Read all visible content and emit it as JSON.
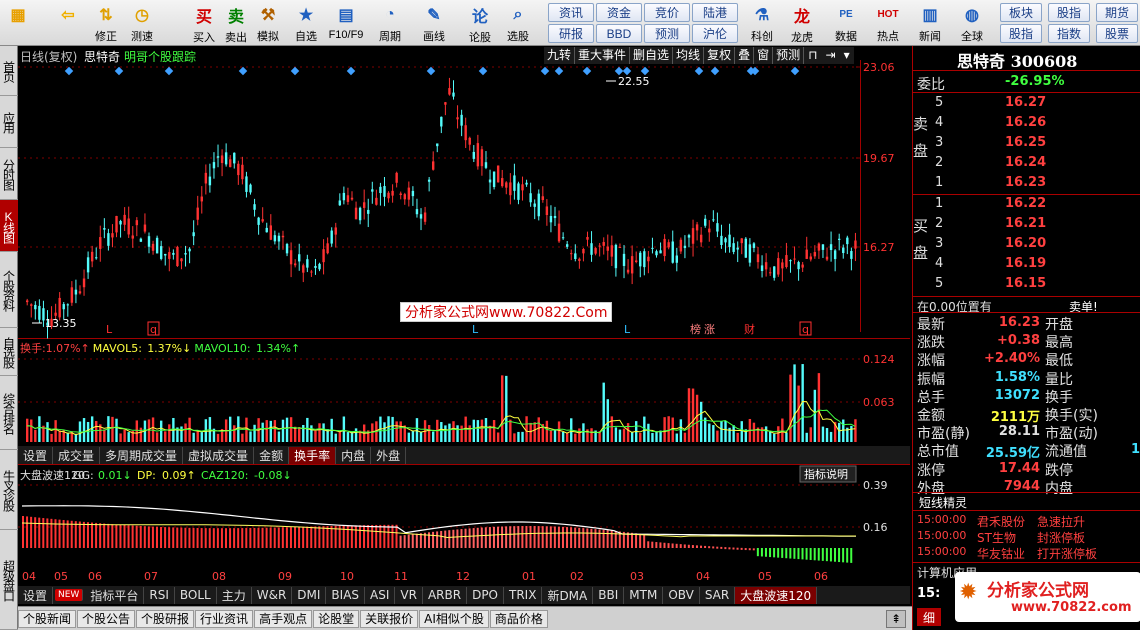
{
  "toolbar": {
    "buttons": [
      {
        "label": "",
        "icon": "grid-icon",
        "color": "#e8a000"
      },
      {
        "label": "",
        "icon": "back-arrow-icon",
        "color": "#f0b000"
      },
      {
        "label": "修正",
        "icon": "updown-arrows-icon",
        "color": "#e0a000"
      },
      {
        "label": "测速",
        "icon": "stopwatch-icon",
        "color": "#e0a000"
      },
      {
        "label": "买入",
        "icon": "buy-icon",
        "color": "#d00000"
      },
      {
        "label": "卖出",
        "icon": "sell-icon",
        "color": "#008000"
      },
      {
        "label": "模拟",
        "icon": "hammer-icon",
        "color": "#b06000"
      },
      {
        "label": "自选",
        "icon": "star-icon",
        "color": "#2060c0"
      },
      {
        "label": "F10/F9",
        "icon": "f10-icon",
        "color": "#2060c0"
      },
      {
        "label": "周期",
        "icon": "clock-icon",
        "color": "#2060c0"
      },
      {
        "label": "画线",
        "icon": "pencil-icon",
        "color": "#2060c0"
      },
      {
        "label": "论股",
        "icon": "chat-icon",
        "color": "#2060c0"
      },
      {
        "label": "选股",
        "icon": "magnifier-icon",
        "color": "#2060c0"
      },
      {
        "label": "科创",
        "icon": "kechuang-icon",
        "color": "#2060c0"
      },
      {
        "label": "龙虎",
        "icon": "dragon-icon",
        "color": "#d00000"
      },
      {
        "label": "数据",
        "icon": "pe-icon",
        "color": "#2060c0"
      },
      {
        "label": "热点",
        "icon": "hot-icon",
        "color": "#d00000"
      },
      {
        "label": "新闻",
        "icon": "news-icon",
        "color": "#2060c0"
      },
      {
        "label": "全球",
        "icon": "globe-icon",
        "color": "#2060c0"
      }
    ],
    "grid_row1": [
      "资讯",
      "资金",
      "竞价",
      "陆港"
    ],
    "grid_row2": [
      "研报",
      "BBD",
      "预测",
      "沪伦"
    ],
    "grid2_row1": [
      "板块",
      "股指",
      "期货"
    ],
    "grid2_row2": [
      "股指",
      "指数",
      "股票"
    ]
  },
  "leftbar": [
    "首页",
    "应用",
    "分时图",
    "K线图",
    "个股资料",
    "自选股",
    "综合排名",
    "牛叉诊股",
    "超级盘口"
  ],
  "header": {
    "period": "日线(复权)",
    "stock_name": "思特奇",
    "follow": "明哥个股跟踪",
    "menu": [
      "九转",
      "重大事件",
      "删自选",
      "均线",
      "复权",
      "叠",
      "窗",
      "预测"
    ]
  },
  "price_axis": [
    "23.06",
    "19.67",
    "16.27"
  ],
  "annotations": {
    "high": "22.55",
    "low": "13.35"
  },
  "markers": [
    {
      "text": "L",
      "color": "#ff3030"
    },
    {
      "text": "q",
      "color": "#ff3030"
    },
    {
      "text": "L",
      "color": "#30c0ff"
    },
    {
      "text": "L",
      "color": "#30c0ff"
    },
    {
      "text": "榜",
      "color": "#ff8080"
    },
    {
      "text": "涨",
      "color": "#ff8080"
    },
    {
      "text": "财",
      "color": "#ff3030"
    },
    {
      "text": "q",
      "color": "#ff3030"
    }
  ],
  "watermark_text": "分析家公式网www.70822.Com",
  "volume": {
    "label_prefix": "换手:",
    "value": "1.07%↑",
    "mavol5_label": "MAVOL5:",
    "mavol5": "1.37%↓",
    "mavol10_label": "MAVOL10:",
    "mavol10": "1.34%↑",
    "axis": [
      "0.124",
      "0.063"
    ]
  },
  "tabs1": [
    "设置",
    "成交量",
    "多周期成交量",
    "虚拟成交量",
    "金额",
    "换手率",
    "内盘",
    "外盘"
  ],
  "indicator": {
    "name": "大盘波速120",
    "gg_label": "GG:",
    "gg": "0.01↓",
    "dp_label": "DP:",
    "dp": "0.09↑",
    "caz_label": "CAZ120:",
    "caz": "-0.08↓",
    "axis": [
      "0.39",
      "0.16"
    ],
    "explain": "指标说明"
  },
  "month_labels": [
    "04",
    "05",
    "06",
    "07",
    "08",
    "09",
    "10",
    "11",
    "12",
    "01",
    "02",
    "03",
    "04",
    "05",
    "06"
  ],
  "tabs2": [
    "设置",
    "NEW",
    "指标平台",
    "RSI",
    "BOLL",
    "主力",
    "W&R",
    "DMI",
    "BIAS",
    "ASI",
    "VR",
    "ARBR",
    "DPO",
    "TRIX",
    "新DMA",
    "BBI",
    "MTM",
    "OBV",
    "SAR",
    "大盘波速120"
  ],
  "bottom_tabs": [
    "个股新闻",
    "个股公告",
    "个股研报",
    "行业资讯",
    "高手观点",
    "论股堂",
    "关联报价",
    "AI相似个股",
    "商品价格"
  ],
  "quote": {
    "title": "思特奇 300608",
    "webi_label": "委比",
    "webi": "-26.95%",
    "sell_label": "卖盘",
    "buy_label": "买盘",
    "asks": [
      {
        "n": "5",
        "p": "16.27"
      },
      {
        "n": "4",
        "p": "16.26"
      },
      {
        "n": "3",
        "p": "16.25"
      },
      {
        "n": "2",
        "p": "16.24"
      },
      {
        "n": "1",
        "p": "16.23"
      }
    ],
    "bids": [
      {
        "n": "1",
        "p": "16.22"
      },
      {
        "n": "2",
        "p": "16.21"
      },
      {
        "n": "3",
        "p": "16.20"
      },
      {
        "n": "4",
        "p": "16.19"
      },
      {
        "n": "5",
        "p": "16.15"
      }
    ],
    "position_text": "在0.00位置有",
    "sell_single": "卖单!",
    "stats": [
      {
        "l": "最新",
        "v": "16.23",
        "c": "#ff4040",
        "r": "开盘"
      },
      {
        "l": "涨跌",
        "v": "+0.38",
        "c": "#ff4040",
        "r": "最高"
      },
      {
        "l": "涨幅",
        "v": "+2.40%",
        "c": "#ff4040",
        "r": "最低"
      },
      {
        "l": "振幅",
        "v": "1.58%",
        "c": "#40e0ff",
        "r": "量比"
      },
      {
        "l": "总手",
        "v": "13072",
        "c": "#40e0ff",
        "r": "换手"
      },
      {
        "l": "金额",
        "v": "2111万",
        "c": "#ffff40",
        "r": "换手(实)"
      },
      {
        "l": "市盈(静)",
        "v": "28.11",
        "c": "#e0e0e0",
        "r": "市盈(动)"
      },
      {
        "l": "总市值",
        "v": "25.59亿",
        "c": "#40e0ff",
        "r": "流通值"
      },
      {
        "l": "涨停",
        "v": "17.44",
        "c": "#ff4040",
        "r": "跌停"
      },
      {
        "l": "外盘",
        "v": "7944",
        "c": "#ff4040",
        "r": "内盘"
      }
    ],
    "stats_extra": "1",
    "elf_title": "短线精灵",
    "elf": [
      {
        "t": "15:00:00",
        "s": "君禾股份",
        "e": "急速拉升"
      },
      {
        "t": "15:00:00",
        "s": "ST生物",
        "e": "封涨停板"
      },
      {
        "t": "15:00:00",
        "s": "华友钴业",
        "e": "打开涨停板"
      }
    ],
    "calc_app": "计算机应用",
    "time_short": "15:",
    "logo_text": "分析家公式网",
    "logo_url": "www.70822.com",
    "bottom_btn": "细"
  }
}
